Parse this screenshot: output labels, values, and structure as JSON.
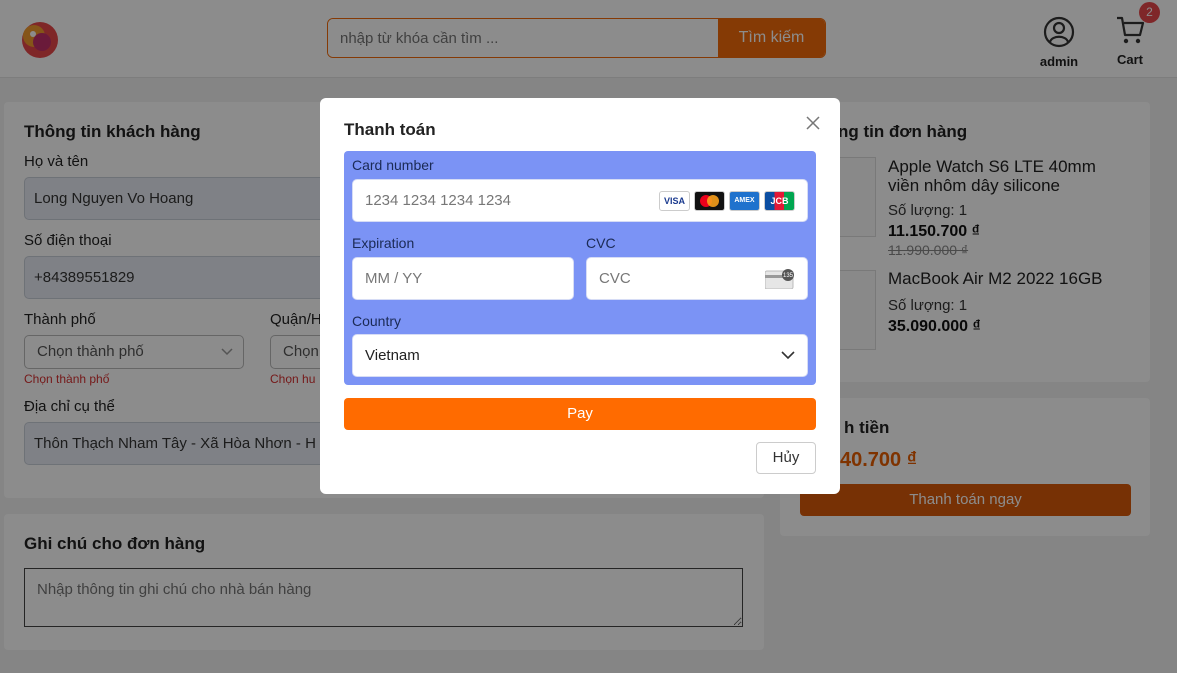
{
  "header": {
    "search_placeholder": "nhập từ khóa cần tìm ...",
    "search_button": "Tìm kiếm",
    "user_label": "admin",
    "cart_label": "Cart",
    "cart_count": "2"
  },
  "customer": {
    "title": "Thông tin khách hàng",
    "name_label": "Họ và tên",
    "name_value": "Long Nguyen Vo Hoang",
    "phone_label": "Số điện thoại",
    "phone_value": "+84389551829",
    "city_label": "Thành phố",
    "city_placeholder": "Chọn thành phố",
    "city_error": "Chọn thành phố",
    "district_label": "Quận/H",
    "district_placeholder": "Chọn",
    "district_error": "Chọn hu",
    "address_label": "Địa chỉ cụ thể",
    "address_value": "Thôn Thạch Nham Tây - Xã Hòa Nhơn - H"
  },
  "note": {
    "title": "Ghi chú cho đơn hàng",
    "placeholder": "Nhập thông tin ghi chú cho nhà bán hàng"
  },
  "order": {
    "title": "ng tin đơn hàng",
    "items": [
      {
        "name_line1": "Apple Watch S6 LTE 40mm",
        "name_line2": "viền nhôm dây silicone",
        "qty": "Số lượng: 1",
        "price": "11.150.700 ₫",
        "old_price": "11.990.000 ₫"
      },
      {
        "name_line1": "MacBook Air M2 2022 16GB",
        "qty": "Số lượng: 1",
        "price": "35.090.000 ₫"
      }
    ]
  },
  "total": {
    "title": "h tiền",
    "amount": "40.700 ₫",
    "pay_now": "Thanh toán ngay"
  },
  "modal": {
    "title": "Thanh toán",
    "card_number_label": "Card number",
    "card_number_placeholder": "1234 1234 1234 1234",
    "brands": [
      "VISA",
      "",
      "AMEX",
      "JCB"
    ],
    "expiration_label": "Expiration",
    "expiration_placeholder": "MM / YY",
    "cvc_label": "CVC",
    "cvc_placeholder": "CVC",
    "cvc_badge": "135",
    "country_label": "Country",
    "country_value": "Vietnam",
    "pay_button": "Pay",
    "cancel_button": "Hủy"
  }
}
